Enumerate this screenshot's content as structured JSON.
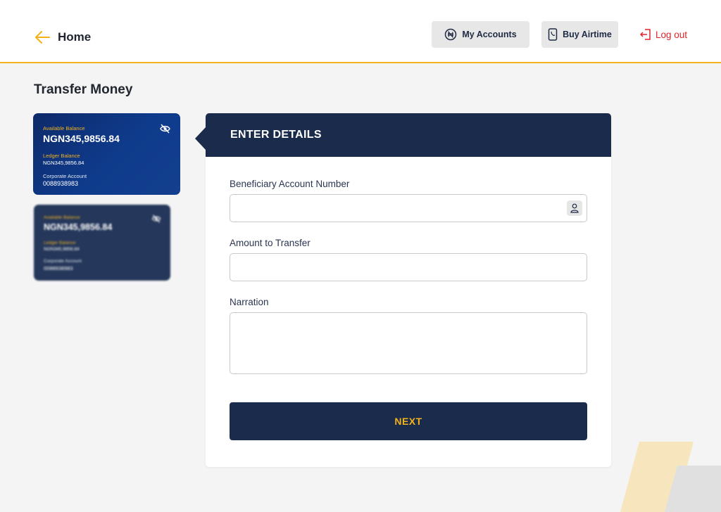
{
  "header": {
    "home_label": "Home",
    "my_accounts_label": "My Accounts",
    "buy_airtime_label": "Buy Airtime",
    "logout_label": "Log out"
  },
  "page": {
    "title": "Transfer Money"
  },
  "accounts": [
    {
      "available_label": "Available Balance",
      "available_balance": "NGN345,9856.84",
      "ledger_label": "Ledger Balance",
      "ledger_balance": "NGN345,9856.84",
      "account_type": "Corporate Account",
      "account_number": "0088938983"
    },
    {
      "available_label": "Available Balance",
      "available_balance": "NGN345,9856.84",
      "ledger_label": "Ledger Balance",
      "ledger_balance": "NGN345,9856.84",
      "account_type": "Corporate Account",
      "account_number": "0088938983"
    }
  ],
  "form": {
    "header": "ENTER DETAILS",
    "beneficiary_label": "Beneficiary Account Number",
    "beneficiary_value": "",
    "amount_label": "Amount to Transfer",
    "amount_value": "",
    "narration_label": "Narration",
    "narration_value": "",
    "next_label": "NEXT"
  },
  "colors": {
    "navy": "#1b2b4b",
    "accent": "#f2b21c",
    "danger": "#e0242b",
    "background": "#f4f4f4"
  },
  "icons": {
    "home": "arrow-left-icon",
    "my_accounts": "naira-coin-icon",
    "buy_airtime": "phone-icon",
    "logout": "logout-icon",
    "balance_toggle": "eye-off-icon",
    "contact_picker": "user-icon"
  }
}
